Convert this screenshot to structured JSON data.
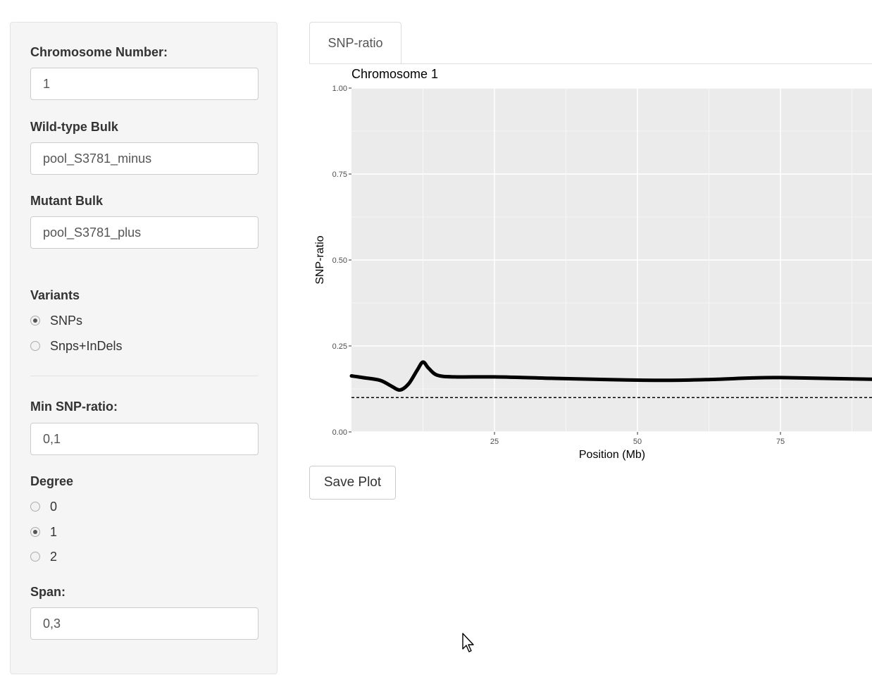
{
  "sidebar": {
    "chromosome_label": "Chromosome Number:",
    "chromosome_value": "1",
    "wildtype_label": "Wild-type Bulk",
    "wildtype_value": "pool_S3781_minus",
    "mutant_label": "Mutant Bulk",
    "mutant_value": "pool_S3781_plus",
    "variants_label": "Variants",
    "variants_options": [
      {
        "label": "SNPs",
        "selected": true
      },
      {
        "label": "Snps+InDels",
        "selected": false
      }
    ],
    "min_ratio_label": "Min SNP-ratio:",
    "min_ratio_value": "0,1",
    "degree_label": "Degree",
    "degree_options": [
      {
        "label": "0",
        "selected": false
      },
      {
        "label": "1",
        "selected": true
      },
      {
        "label": "2",
        "selected": false
      }
    ],
    "span_label": "Span:",
    "span_value": "0,3"
  },
  "main": {
    "tab_label": "SNP-ratio",
    "save_button": "Save Plot",
    "cursor_icon": "mouse-pointer-icon"
  },
  "chart_data": {
    "type": "line",
    "title": "Chromosome 1",
    "xlabel": "Position (Mb)",
    "ylabel": "SNP-ratio",
    "xlim": [
      0,
      91
    ],
    "ylim": [
      0,
      1
    ],
    "x_ticks": [
      "25",
      "50",
      "75"
    ],
    "y_ticks": [
      "0.00",
      "0.25",
      "0.50",
      "0.75",
      "1.00"
    ],
    "grid": true,
    "threshold": 0.1,
    "series": [
      {
        "color": "#000000",
        "x": [
          0,
          2,
          5,
          7,
          8.5,
          10,
          11.5,
          12.5,
          13.5,
          15,
          18,
          25,
          35,
          45,
          55,
          62,
          70,
          75,
          85,
          91
        ],
        "y": [
          0.163,
          0.158,
          0.15,
          0.133,
          0.122,
          0.14,
          0.18,
          0.203,
          0.185,
          0.165,
          0.16,
          0.16,
          0.156,
          0.152,
          0.15,
          0.152,
          0.157,
          0.158,
          0.155,
          0.153
        ]
      }
    ]
  }
}
